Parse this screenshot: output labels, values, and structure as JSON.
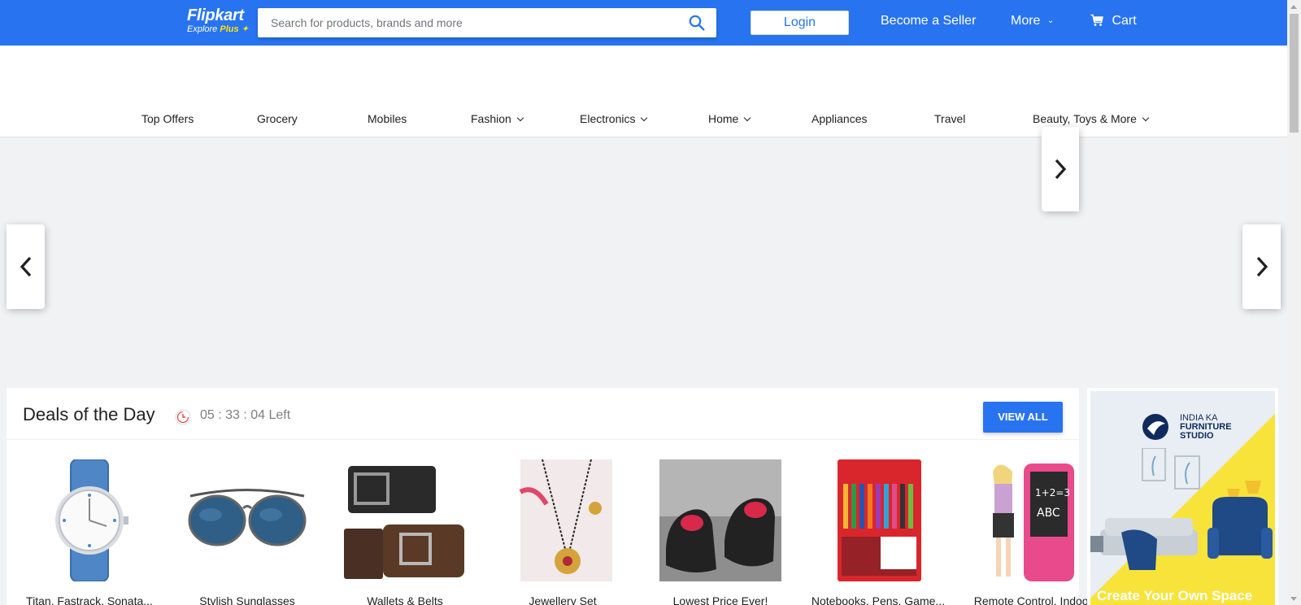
{
  "header": {
    "logo_name": "Flipkart",
    "logo_sub_explore": "Explore",
    "logo_sub_plus": "Plus",
    "search_placeholder": "Search for products, brands and more",
    "login_label": "Login",
    "seller_label": "Become a Seller",
    "more_label": "More",
    "cart_label": "Cart",
    "brand_color": "#2874f0"
  },
  "categories": [
    {
      "label": "Top Offers",
      "dropdown": false
    },
    {
      "label": "Grocery",
      "dropdown": false
    },
    {
      "label": "Mobiles",
      "dropdown": false
    },
    {
      "label": "Fashion",
      "dropdown": true
    },
    {
      "label": "Electronics",
      "dropdown": true
    },
    {
      "label": "Home",
      "dropdown": true
    },
    {
      "label": "Appliances",
      "dropdown": false
    },
    {
      "label": "Travel",
      "dropdown": false
    },
    {
      "label": "Beauty, Toys & More",
      "dropdown": true
    }
  ],
  "deals": {
    "title": "Deals of the Day",
    "timer": "05 : 33 : 04 Left",
    "view_all_label": "VIEW ALL",
    "items": [
      {
        "label": "Titan, Fastrack, Sonata...",
        "icon": "watch-image"
      },
      {
        "label": "Stylish Sunglasses",
        "icon": "sunglasses-image"
      },
      {
        "label": "Wallets & Belts",
        "icon": "wallet-belt-image"
      },
      {
        "label": "Jewellery Set",
        "icon": "jewellery-image"
      },
      {
        "label": "Lowest Price Ever!",
        "icon": "shoes-image"
      },
      {
        "label": "Notebooks, Pens, Game...",
        "icon": "pens-image"
      },
      {
        "label": "Remote Control, Indoo...",
        "icon": "toys-image"
      }
    ]
  },
  "ad": {
    "brand_line1": "INDIA KA",
    "brand_line2": "FURNITURE",
    "brand_line3": "STUDIO",
    "cta": "Create Your Own Space"
  }
}
